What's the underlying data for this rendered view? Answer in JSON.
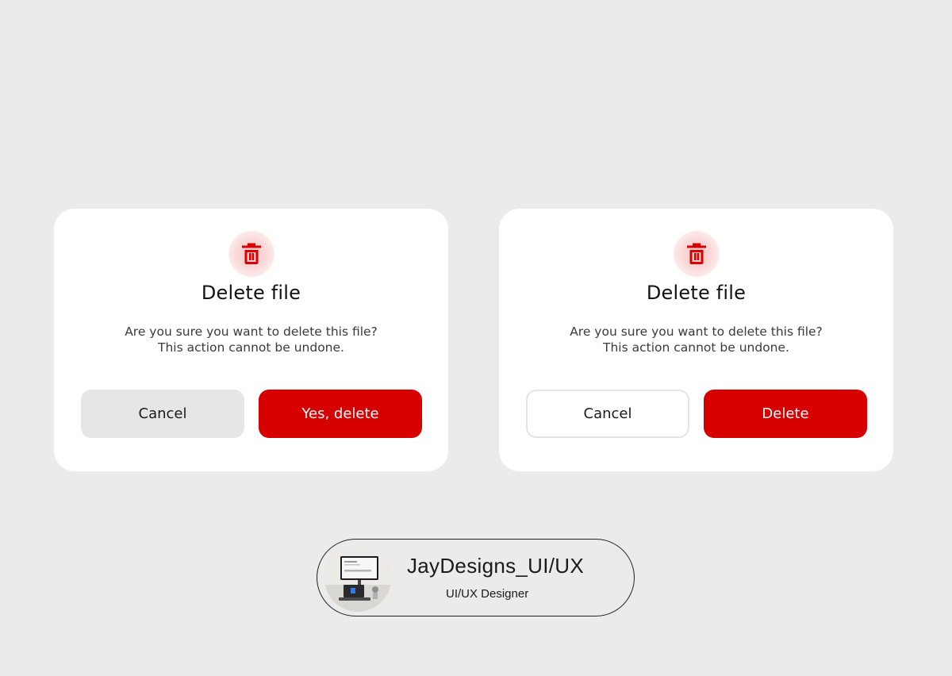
{
  "colors": {
    "background": "#ebebeb",
    "card": "#ffffff",
    "danger": "#d70000",
    "icon_halo": "#f8c4c4",
    "cancel_fill": "#e6e6e6",
    "outline": "#e4e4e4"
  },
  "dialogs": [
    {
      "icon": "trash-icon",
      "title": "Delete file",
      "message_line_1": "Are you sure you want to delete this file?",
      "message_line_2": "This action cannot be undone.",
      "cancel_label": "Cancel",
      "cancel_style": "filled-gray",
      "confirm_label": "Yes, delete"
    },
    {
      "icon": "trash-icon",
      "title": "Delete file",
      "message_line_1": "Are you sure you want to delete this file?",
      "message_line_2": "This action cannot be undone.",
      "cancel_label": "Cancel",
      "cancel_style": "outlined",
      "confirm_label": "Delete"
    }
  ],
  "profile": {
    "name": "JayDesigns_UI/UX",
    "role": "UI/UX Designer",
    "avatar": "avatar-photo-desk-setup"
  }
}
